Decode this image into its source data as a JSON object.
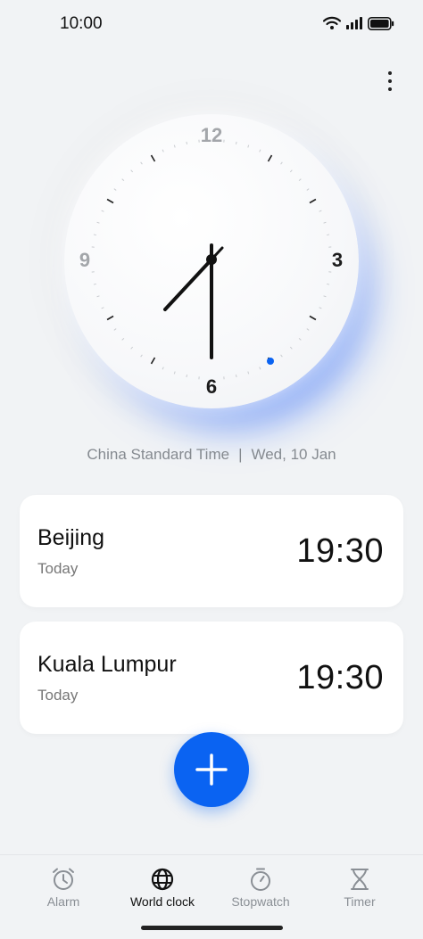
{
  "status_bar": {
    "time": "10:00"
  },
  "clock": {
    "numerals": {
      "twelve": "12",
      "three": "3",
      "six": "6",
      "nine": "9"
    },
    "accent_color": "#0a63f2"
  },
  "timezone": {
    "name": "China Standard Time",
    "separator": "|",
    "date": "Wed, 10 Jan"
  },
  "cities": [
    {
      "name": "Beijing",
      "day": "Today",
      "time": "19:30"
    },
    {
      "name": "Kuala Lumpur",
      "day": "Today",
      "time": "19:30"
    }
  ],
  "add_button": {
    "icon": "plus-icon"
  },
  "more_button": {
    "icon": "more-vertical-icon"
  },
  "nav": [
    {
      "label": "Alarm",
      "icon": "alarm-icon",
      "active": false
    },
    {
      "label": "World clock",
      "icon": "globe-icon",
      "active": true
    },
    {
      "label": "Stopwatch",
      "icon": "stopwatch-icon",
      "active": false
    },
    {
      "label": "Timer",
      "icon": "hourglass-icon",
      "active": false
    }
  ]
}
